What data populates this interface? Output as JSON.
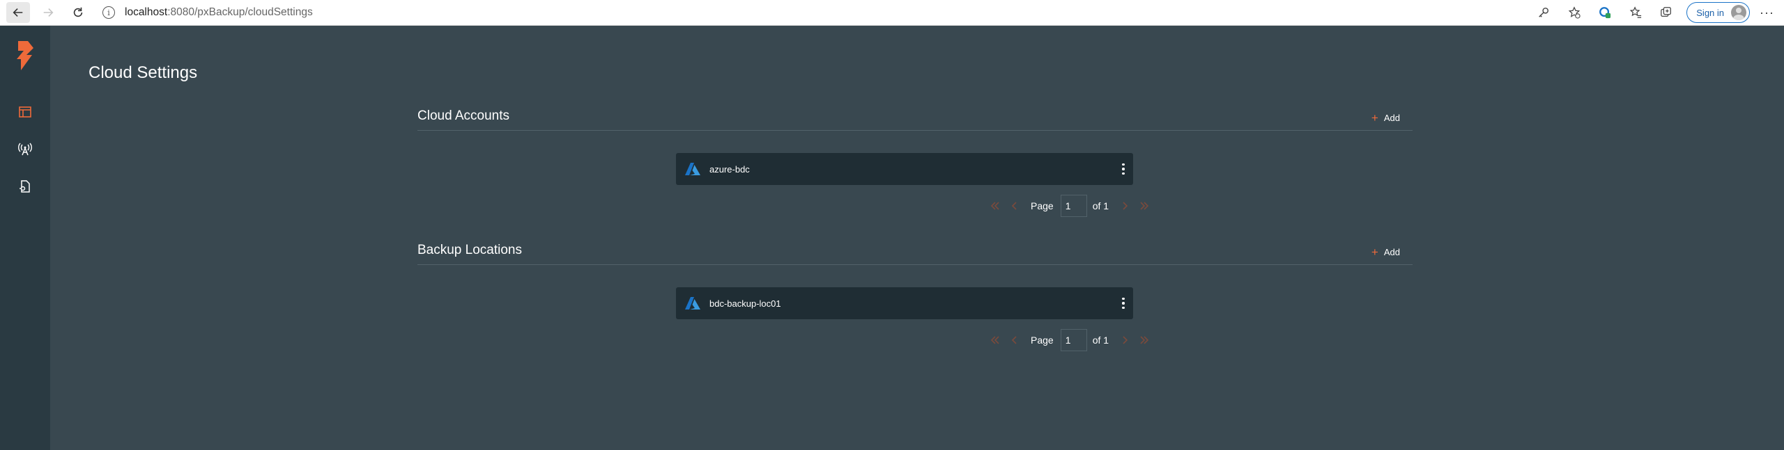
{
  "browser": {
    "url_host": "localhost",
    "url_rest": ":8080/pxBackup/cloudSettings",
    "sign_in_label": "Sign in",
    "more_label": "···"
  },
  "page": {
    "title": "Cloud Settings"
  },
  "sections": [
    {
      "title": "Cloud Accounts",
      "add_label": "Add",
      "items": [
        {
          "name": "azure-bdc",
          "provider_icon": "azure-icon"
        }
      ],
      "pagination": {
        "page_label": "Page",
        "current_page": "1",
        "of_label": "of 1"
      }
    },
    {
      "title": "Backup Locations",
      "add_label": "Add",
      "items": [
        {
          "name": "bdc-backup-loc01",
          "provider_icon": "azure-icon"
        }
      ],
      "pagination": {
        "page_label": "Page",
        "current_page": "1",
        "of_label": "of 1"
      }
    }
  ],
  "colors": {
    "background": "#394850",
    "sidebar": "#2a3a42",
    "card": "#1f2d34",
    "accent": "#ef6a3a",
    "azure_blue": "#1a73c7"
  }
}
